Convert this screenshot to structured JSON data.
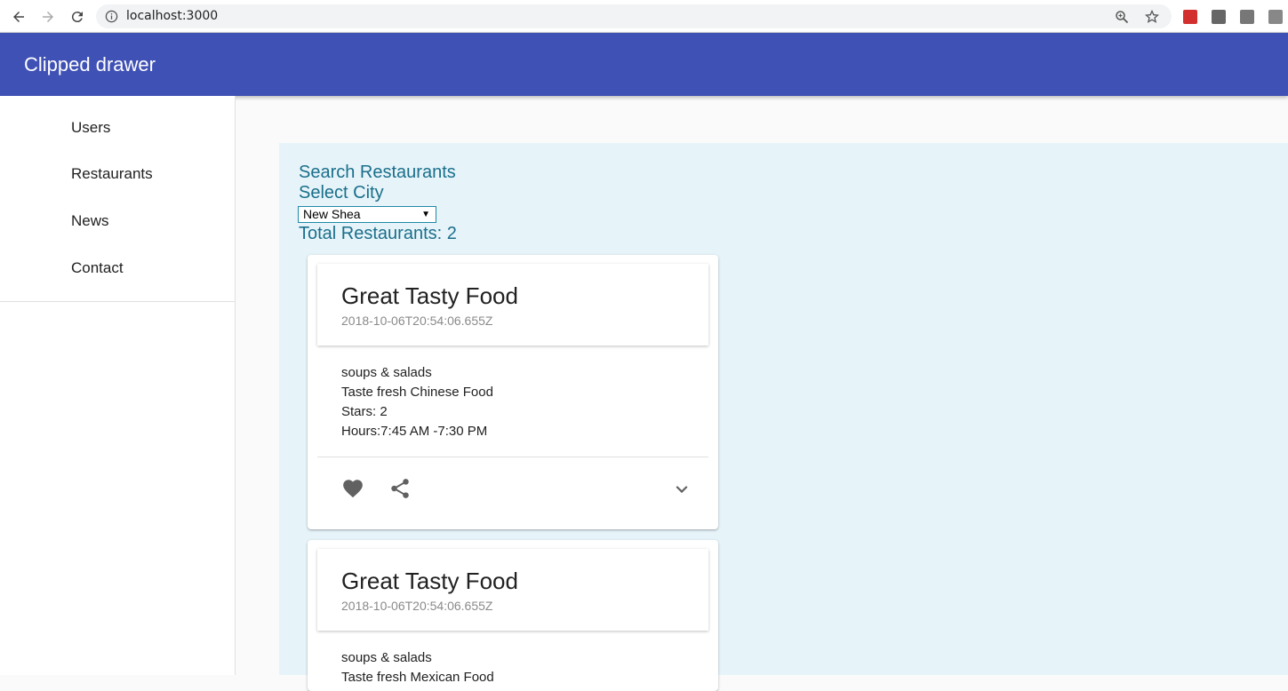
{
  "browser": {
    "url": "localhost:3000"
  },
  "app": {
    "title": "Clipped drawer"
  },
  "drawer": {
    "items": [
      {
        "label": "Users"
      },
      {
        "label": "Restaurants"
      },
      {
        "label": "News"
      },
      {
        "label": "Contact"
      }
    ]
  },
  "main": {
    "search_heading": "Search Restaurants",
    "select_city_label": "Select City",
    "city_selected": "New Shea",
    "total_label": "Total Restaurants: 2"
  },
  "restaurants": [
    {
      "name": "Great Tasty Food",
      "date": "2018-10-06T20:54:06.655Z",
      "category": "soups & salads",
      "description": "Taste fresh Chinese Food",
      "stars": "Stars: 2",
      "hours": "Hours:7:45 AM -7:30 PM"
    },
    {
      "name": "Great Tasty Food",
      "date": "2018-10-06T20:54:06.655Z",
      "category": "soups & salads",
      "description": "Taste fresh Mexican Food"
    }
  ],
  "icons": {
    "back": "arrow-back-icon",
    "forward": "arrow-forward-icon",
    "reload": "reload-icon",
    "info": "info-icon",
    "zoom": "zoom-icon",
    "star": "bookmark-star-icon",
    "favorite": "heart-icon",
    "share": "share-icon",
    "expand": "chevron-down-icon"
  },
  "colors": {
    "primary": "#3f51b5",
    "panel": "#e6f4fa",
    "heading": "#1a6e8a"
  }
}
